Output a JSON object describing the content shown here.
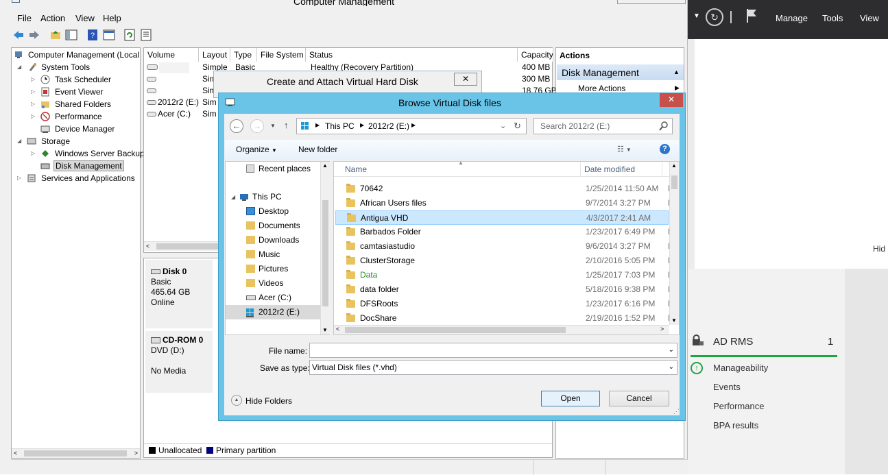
{
  "window": {
    "title": "Computer Management"
  },
  "menu": [
    "File",
    "Action",
    "View",
    "Help"
  ],
  "tree": {
    "root": "Computer Management (Local",
    "system_tools": "System Tools",
    "task_scheduler": "Task Scheduler",
    "event_viewer": "Event Viewer",
    "shared_folders": "Shared Folders",
    "performance": "Performance",
    "device_manager": "Device Manager",
    "storage": "Storage",
    "wsb": "Windows Server Backup",
    "disk_mgmt": "Disk Management",
    "services": "Services and Applications"
  },
  "volumes": {
    "headers": [
      "Volume",
      "Layout",
      "Type",
      "File System",
      "Status",
      "Capacity"
    ],
    "rows": [
      {
        "volume": "",
        "layout": "Simple",
        "type": "Basic",
        "status": "Healthy (Recovery Partition)",
        "capacity": "400 MB"
      },
      {
        "volume": "",
        "layout": "Sim",
        "type": "",
        "status": "",
        "capacity": "300 MB"
      },
      {
        "volume": "",
        "layout": "Sim",
        "type": "",
        "status": "",
        "capacity": "18.76 GB"
      },
      {
        "volume": "2012r2 (E:)",
        "layout": "Sim",
        "type": "",
        "status": "",
        "capacity": ""
      },
      {
        "volume": "Acer (C:)",
        "layout": "Sim",
        "type": "",
        "status": "",
        "capacity": ""
      }
    ]
  },
  "disks": {
    "disk0": {
      "name": "Disk 0",
      "type": "Basic",
      "size": "465.64 GB",
      "state": "Online"
    },
    "cdrom0": {
      "name": "CD-ROM 0",
      "type": "DVD (D:)",
      "state": "No Media"
    }
  },
  "legend": {
    "unallocated": "Unallocated",
    "primary": "Primary partition"
  },
  "actions": {
    "header": "Actions",
    "section": "Disk Management",
    "more": "More Actions"
  },
  "server_manager": {
    "toolbar": {
      "manage": "Manage",
      "tools": "Tools",
      "view": "View"
    },
    "hide": "Hid",
    "tile": {
      "title": "AD RMS",
      "count": "1",
      "items": [
        "Manageability",
        "Events",
        "Performance",
        "BPA results"
      ]
    }
  },
  "dialog_back": {
    "title": "Create and Attach Virtual Hard Disk",
    "close": "✕"
  },
  "dialog": {
    "title": "Browse Virtual Disk files",
    "close": "✕",
    "breadcrumb": [
      "This PC",
      "2012r2 (E:)"
    ],
    "search_placeholder": "Search 2012r2 (E:)",
    "organize": "Organize",
    "new_folder": "New folder",
    "nav": {
      "recent": "Recent places",
      "this_pc": "This PC",
      "desktop": "Desktop",
      "documents": "Documents",
      "downloads": "Downloads",
      "music": "Music",
      "pictures": "Pictures",
      "videos": "Videos",
      "acer": "Acer (C:)",
      "e_drive": "2012r2 (E:)"
    },
    "columns": {
      "name": "Name",
      "date": "Date modified",
      "type": "T"
    },
    "files": [
      {
        "name": "70642",
        "date": "1/25/2014 11:50 AM",
        "type": "F"
      },
      {
        "name": "African Users files",
        "date": "9/7/2014 3:27 PM",
        "type": "F"
      },
      {
        "name": "Antigua VHD",
        "date": "4/3/2017 2:41 AM",
        "type": "F"
      },
      {
        "name": "Barbados Folder",
        "date": "1/23/2017 6:49 PM",
        "type": "F"
      },
      {
        "name": "camtasiastudio",
        "date": "9/6/2014 3:27 PM",
        "type": "F"
      },
      {
        "name": "ClusterStorage",
        "date": "2/10/2016 5:05 PM",
        "type": "F"
      },
      {
        "name": "Data",
        "date": "1/25/2017 7:03 PM",
        "type": "F"
      },
      {
        "name": "data folder",
        "date": "5/18/2016 9:38 PM",
        "type": "F"
      },
      {
        "name": "DFSRoots",
        "date": "1/23/2017 6:16 PM",
        "type": "F"
      },
      {
        "name": "DocShare",
        "date": "2/19/2016 1:52 PM",
        "type": "F"
      }
    ],
    "file_name_label": "File name:",
    "file_name_value": "",
    "save_type_label": "Save as type:",
    "save_type_value": "Virtual Disk files (*.vhd)",
    "hide_folders": "Hide Folders",
    "open": "Open",
    "cancel": "Cancel"
  }
}
